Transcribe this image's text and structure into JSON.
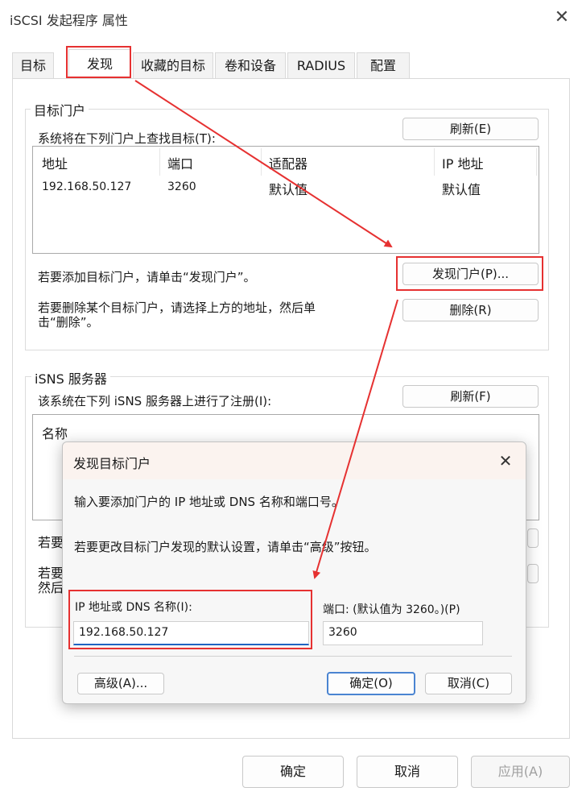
{
  "window": {
    "title": "iSCSI 发起程序 属性",
    "close_glyph": "✕"
  },
  "tabs": [
    {
      "label": "目标"
    },
    {
      "label": "发现"
    },
    {
      "label": "收藏的目标"
    },
    {
      "label": "卷和设备"
    },
    {
      "label": "RADIUS"
    },
    {
      "label": "配置"
    }
  ],
  "target_portals": {
    "group_label": "目标门户",
    "description": "系统将在下列门户上查找目标(T):",
    "refresh_label": "刷新(E)",
    "columns": [
      "地址",
      "端口",
      "适配器",
      "IP 地址"
    ],
    "rows": [
      {
        "address": "192.168.50.127",
        "port": "3260",
        "adapter": "默认值",
        "ip": "默认值"
      }
    ],
    "add_hint": "若要添加目标门户，请单击“发现门户”。",
    "discover_label": "发现门户(P)...",
    "remove_hint_line1": "若要删除某个目标门户，请选择上方的地址，然后单",
    "remove_hint_line2": "击“删除”。",
    "remove_label": "删除(R)"
  },
  "isns": {
    "group_label": "iSNS 服务器",
    "description": "该系统在下列 iSNS 服务器上进行了注册(I):",
    "refresh_label": "刷新(F)",
    "column_name": "名称",
    "partial_text_1": "若要",
    "partial_text_2a": "若要",
    "partial_text_2b": "然后"
  },
  "footer": {
    "ok_label": "确定",
    "cancel_label": "取消",
    "apply_label": "应用(A)"
  },
  "dialog": {
    "title": "发现目标门户",
    "close_glyph": "✕",
    "instruction": "输入要添加门户的 IP 地址或 DNS 名称和端口号。",
    "advanced_hint": "若要更改目标门户发现的默认设置，请单击“高级”按钮。",
    "ip_label": "IP 地址或 DNS 名称(I):",
    "ip_value": "192.168.50.127",
    "port_label": "端口: (默认值为 3260。)(P)",
    "port_value": "3260",
    "advanced_label": "高级(A)...",
    "ok_label": "确定(O)",
    "cancel_label": "取消(C)"
  },
  "colors": {
    "annotation_red": "#e63131",
    "accent_blue": "#2064c2"
  }
}
